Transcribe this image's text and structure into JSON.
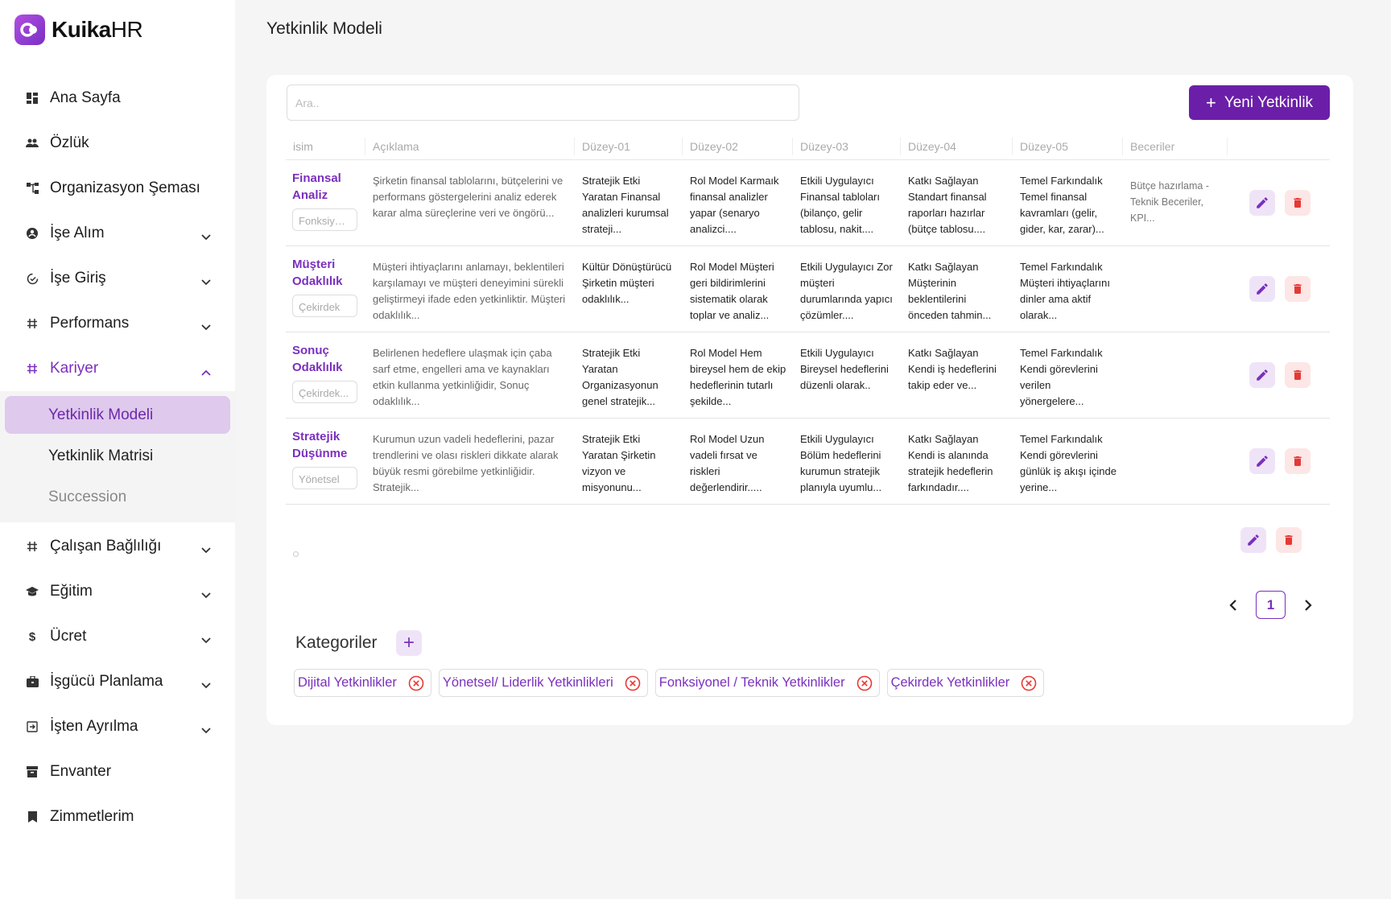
{
  "app": {
    "logo_bold": "Kuika",
    "logo_light": "HR"
  },
  "sidebar": {
    "items": [
      {
        "label": "Ana Sayfa",
        "icon": "dashboard-icon",
        "expandable": false
      },
      {
        "label": "Özlük",
        "icon": "people-icon",
        "expandable": false
      },
      {
        "label": "Organizasyon Şeması",
        "icon": "org-chart-icon",
        "expandable": false
      },
      {
        "label": "İşe Alım",
        "icon": "user-circle-icon",
        "expandable": true
      },
      {
        "label": "İşe Giriş",
        "icon": "onboarding-icon",
        "expandable": true
      },
      {
        "label": "Performans",
        "icon": "hash-icon",
        "expandable": true
      },
      {
        "label": "Kariyer",
        "icon": "hash-icon",
        "expandable": true,
        "active": true
      }
    ],
    "kariyer_sub": [
      {
        "label": "Yetkinlik Modeli",
        "selected": true
      },
      {
        "label": "Yetkinlik Matrisi"
      },
      {
        "label": "Succession"
      }
    ],
    "items_after": [
      {
        "label": "Çalışan Bağlılığı",
        "icon": "hash-icon",
        "expandable": true
      },
      {
        "label": "Eğitim",
        "icon": "graduation-icon",
        "expandable": true
      },
      {
        "label": "Ücret",
        "icon": "dollar-icon",
        "expandable": true
      },
      {
        "label": "İşgücü Planlama",
        "icon": "briefcase-icon",
        "expandable": true
      },
      {
        "label": "İşten Ayrılma",
        "icon": "exit-icon",
        "expandable": true
      },
      {
        "label": "Envanter",
        "icon": "archive-icon",
        "expandable": false
      },
      {
        "label": "Zimmetlerim",
        "icon": "bookmark-icon",
        "expandable": false
      }
    ]
  },
  "page": {
    "title": "Yetkinlik Modeli"
  },
  "toolbar": {
    "search_placeholder": "Ara..",
    "search_value": "",
    "new_button": "Yeni Yetkinlik"
  },
  "table": {
    "headers": [
      "isim",
      "Açıklama",
      "Düzey-01",
      "Düzey-02",
      "Düzey-03",
      "Düzey-04",
      "Düzey-05",
      "Beceriler"
    ],
    "rows": [
      {
        "name": "Finansal Analiz",
        "tag": "Fonksiyon...",
        "desc": "Şirketin finansal tablolarını, bütçelerini ve performans göstergelerini analiz ederek karar alma süreçlerine veri ve öngörü...",
        "l1": "Stratejik Etki Yaratan Finansal analizleri kurumsal strateji...",
        "l2": "Rol Model Karmaık finansal analizler yapar (senaryo analizci....",
        "l3": "Etkili Uygulayıcı Finansal tabloları (bilanço, gelir tablosu, nakit....",
        "l4": "Katkı Sağlayan Standart finansal raporları hazırlar (bütçe tablosu....",
        "l5": "Temel Farkındalık Temel finansal kavramları (gelir, gider, kar, zarar)...",
        "skill": "Bütçe hazırlama -Teknik Beceriler, KPI..."
      },
      {
        "name": "Müşteri Odaklılık",
        "tag": "Çekirdek",
        "desc": "Müşteri ihtiyaçlarını anlamayı, beklentileri karşılamayı ve müşteri deneyimini sürekli geliştirmeyi ifade eden yetkinliktir. Müşteri odaklılık...",
        "l1": "Kültür Dönüştürücü Şirketin müşteri odaklılık...",
        "l2": "Rol Model Müşteri geri bildirimlerini sistematik olarak toplar ve analiz...",
        "l3": "Etkili Uygulayıcı Zor müşteri durumlarında yapıcı çözümler....",
        "l4": "Katkı Sağlayan Müşterinin beklentilerini önceden tahmin...",
        "l5": "Temel Farkındalık Müşteri ihtiyaçlarını dinler ama aktif olarak...",
        "skill": ""
      },
      {
        "name": "Sonuç Odaklılık",
        "tag": "Çekirdek...",
        "desc": "Belirlenen hedeflere ulaşmak için çaba sarf etme, engelleri ama ve kaynakları etkin kullanma yetkinliğidir, Sonuç odaklılık...",
        "l1": "Stratejik Etki Yaratan Organizasyonun genel stratejik...",
        "l2": "Rol Model Hem bireysel hem de ekip hedeflerinin tutarlı şekilde...",
        "l3": "Etkili Uygulayıcı Bireysel hedeflerini düzenli olarak..",
        "l4": "Katkı Sağlayan Kendi iş hedeflerini takip eder ve...",
        "l5": "Temel Farkındalık Kendi görevlerini verilen yönergelere...",
        "skill": ""
      },
      {
        "name": "Stratejik Düşünme",
        "tag": "Yönetsel",
        "desc": "Kurumun uzun vadeli hedeflerini, pazar trendlerini ve olası riskleri dikkate alarak büyük resmi görebilme yetkinliğidir. Stratejik...",
        "l1": "Stratejik Etki Yaratan Şirketin vizyon ve misyonunu...",
        "l2": "Rol Model Uzun vadeli fırsat ve riskleri değerlendirir.....",
        "l3": "Etkili Uygulayıcı Bölüm hedeflerini kurumun stratejik planıyla uyumlu...",
        "l4": "Katkı Sağlayan Kendi is alanında stratejik hedeflerin farkındadır....",
        "l5": "Temel Farkındalık Kendi görevlerini günlük iş akışı içinde yerine...",
        "skill": ""
      }
    ]
  },
  "pagination": {
    "current": "1"
  },
  "categories": {
    "title": "Kategoriler",
    "items": [
      "Dijital Yetkinlikler",
      "Yönetsel/ Liderlik Yetkinlikleri",
      "Fonksiyonel / Teknik Yetkinlikler",
      "Çekirdek Yetkinlikler"
    ]
  },
  "colors": {
    "brand": "#6b1fa8",
    "accent": "#7b2fbe",
    "danger": "#e53935",
    "selected_bg": "#dfc9ec"
  }
}
